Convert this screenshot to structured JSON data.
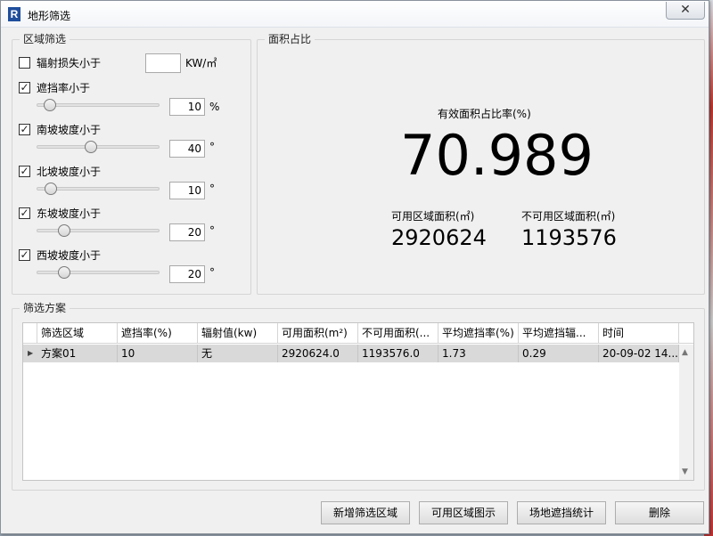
{
  "window": {
    "title": "地形筛选",
    "app_icon_letter": "R",
    "close_glyph": "✕"
  },
  "region_filter": {
    "title": "区域筛选",
    "rows": [
      {
        "label": "辐射损失小于",
        "checked": false,
        "value": "",
        "unit": "KW/㎡"
      },
      {
        "label": "遮挡率小于",
        "checked": true,
        "value": "10",
        "unit": "%",
        "slider": 0.1
      },
      {
        "label": "南坡坡度小于",
        "checked": true,
        "value": "40",
        "unit": "°",
        "slider": 0.44
      },
      {
        "label": "北坡坡度小于",
        "checked": true,
        "value": "10",
        "unit": "°",
        "slider": 0.1
      },
      {
        "label": "东坡坡度小于",
        "checked": true,
        "value": "20",
        "unit": "°",
        "slider": 0.22
      },
      {
        "label": "西坡坡度小于",
        "checked": true,
        "value": "20",
        "unit": "°",
        "slider": 0.22
      }
    ]
  },
  "area_ratio": {
    "title": "面积占比",
    "ratio_label": "有效面积占比率(%)",
    "ratio_value": "70.989",
    "usable_label": "可用区域面积(㎡)",
    "usable_value": "2920624",
    "unusable_label": "不可用区域面积(㎡)",
    "unusable_value": "1193576"
  },
  "scheme": {
    "title": "筛选方案",
    "columns": [
      "筛选区域",
      "遮挡率(%)",
      "辐射值(kw)",
      "可用面积(m²)",
      "不可用面积(...",
      "平均遮挡率(%)",
      "平均遮挡辐...",
      "时间"
    ],
    "rows": [
      [
        "方案01",
        "10",
        "无",
        "2920624.0",
        "1193576.0",
        "1.73",
        "0.29",
        "20-09-02 14..."
      ]
    ],
    "row_indicator": "▶",
    "scroll_up": "▲",
    "scroll_down": "▼"
  },
  "buttons": {
    "add_region": "新增筛选区域",
    "show_usable": "可用区域图示",
    "shading_stats": "场地遮挡统计",
    "delete": "删除"
  }
}
